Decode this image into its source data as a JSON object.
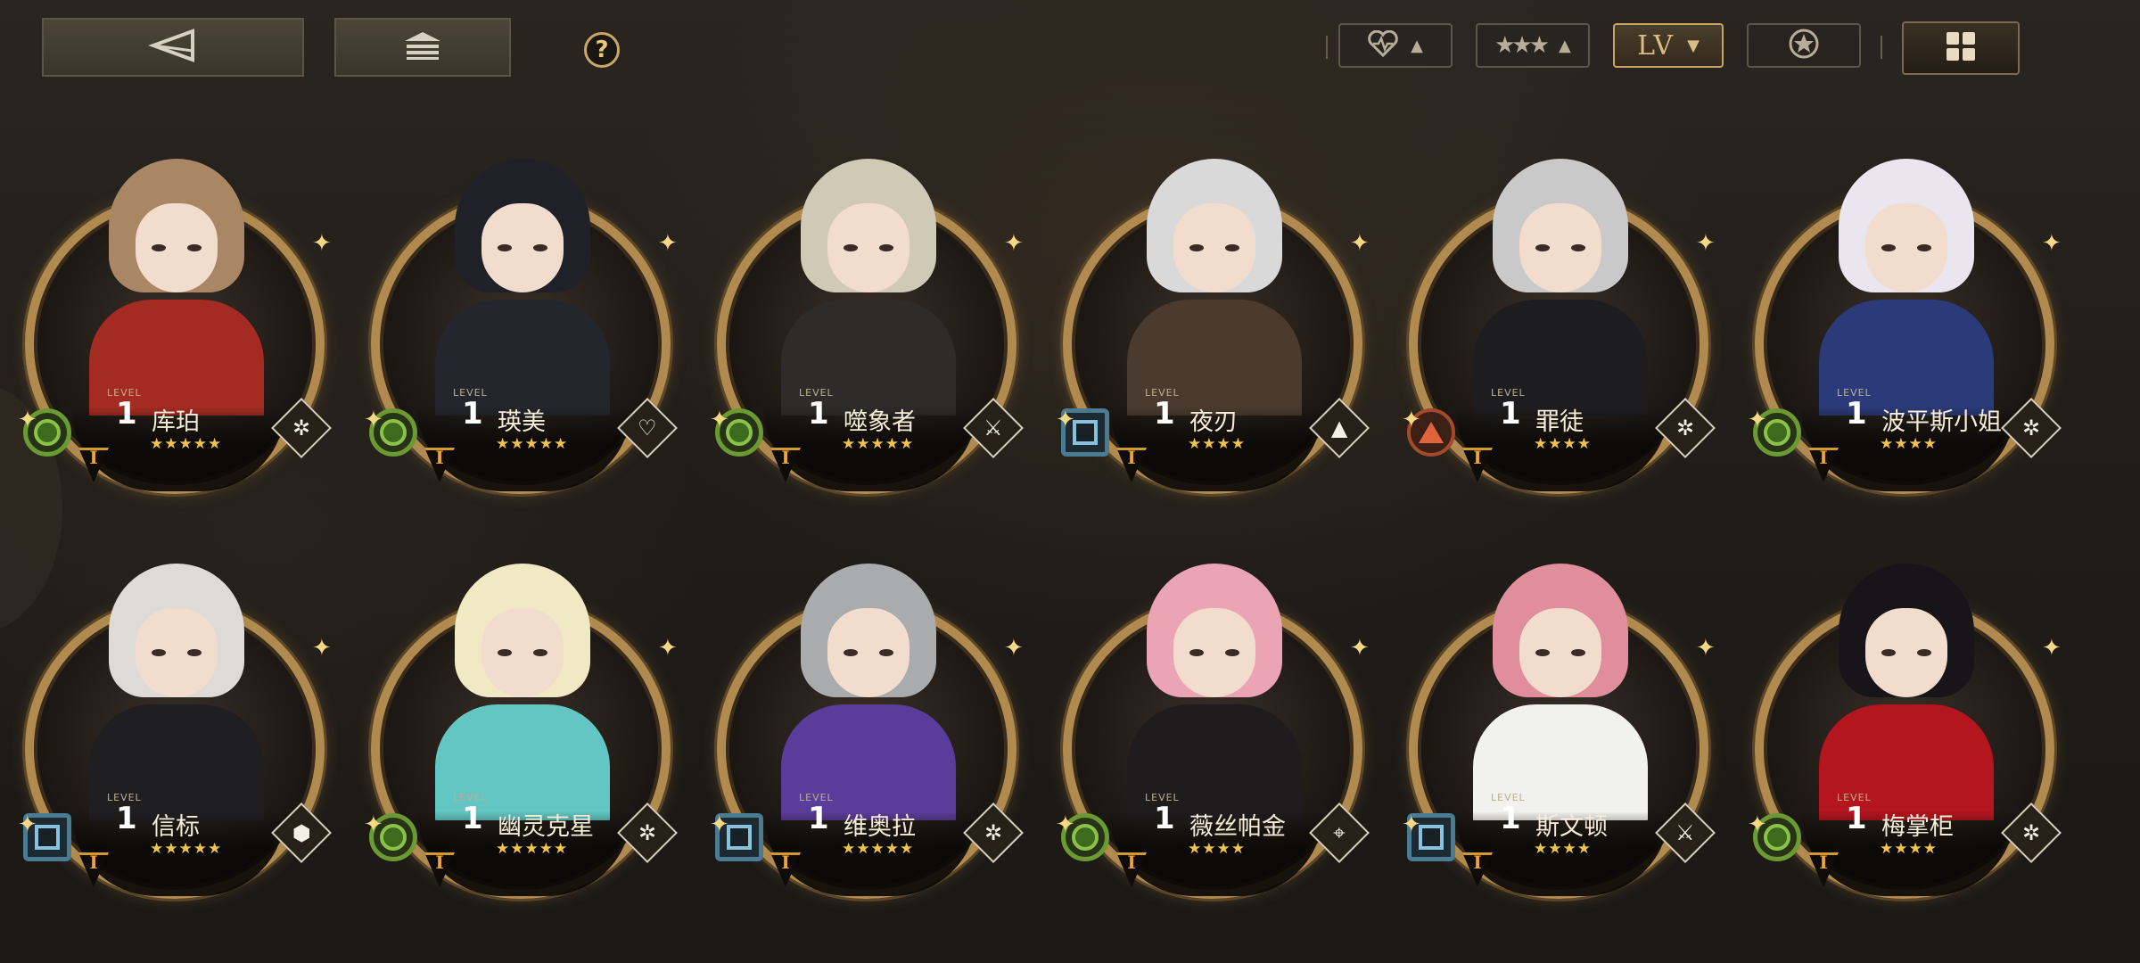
{
  "topbar": {
    "back_icon": "back-arrow-icon",
    "home_icon": "stack-icon",
    "help_label": "?",
    "filters": [
      {
        "icon": "heart-rate-icon",
        "caret": "▲",
        "active": false
      },
      {
        "icon": "three-stars-icon",
        "caret": "▲",
        "active": false
      },
      {
        "label": "LV",
        "caret": "▼",
        "active": true
      },
      {
        "icon": "star-badge-icon",
        "active": false
      }
    ],
    "layout_icon": "grid-icon"
  },
  "level_tag": "LEVEL",
  "characters": [
    {
      "name": "库珀",
      "level": "1",
      "rank": "I",
      "stars": "★★★★★",
      "element": "circle",
      "role_icon": "gear-flower-icon",
      "hair": "#a98664",
      "outfit": "#a32b22"
    },
    {
      "name": "瑛美",
      "level": "1",
      "rank": "I",
      "stars": "★★★★★",
      "element": "circle",
      "role_icon": "heart-shield-icon",
      "hair": "#1f2028",
      "outfit": "#23262c"
    },
    {
      "name": "噬象者",
      "level": "1",
      "rank": "I",
      "stars": "★★★★★",
      "element": "circle",
      "role_icon": "crossed-blades-icon",
      "hair": "#cfc9b6",
      "outfit": "#2e2c2a"
    },
    {
      "name": "夜刃",
      "level": "1",
      "rank": "I",
      "stars": "★★★★",
      "element": "square",
      "role_icon": "tent-icon",
      "hair": "#d9d9d9",
      "outfit": "#4a3b2e"
    },
    {
      "name": "罪徒",
      "level": "1",
      "rank": "I",
      "stars": "★★★★",
      "element": "triangle",
      "role_icon": "gear-flower-icon",
      "hair": "#c9c9c9",
      "outfit": "#1d1d1f"
    },
    {
      "name": "波平斯小姐",
      "level": "1",
      "rank": "I",
      "stars": "★★★★",
      "element": "circle",
      "role_icon": "gear-flower-icon",
      "hair": "#e9e6ef",
      "outfit": "#2b3a78"
    },
    {
      "name": "信标",
      "level": "1",
      "rank": "I",
      "stars": "★★★★★",
      "element": "square",
      "role_icon": "hex-cluster-icon",
      "hair": "#dedbd6",
      "outfit": "#1f1f22"
    },
    {
      "name": "幽灵克星",
      "level": "1",
      "rank": "I",
      "stars": "★★★★★",
      "element": "circle",
      "role_icon": "gear-flower-icon",
      "hair": "#f1e8c4",
      "outfit": "#63c6c3"
    },
    {
      "name": "维奥拉",
      "level": "1",
      "rank": "I",
      "stars": "★★★★★",
      "element": "square",
      "role_icon": "gear-flower-icon",
      "hair": "#a9abad",
      "outfit": "#5a3d9a"
    },
    {
      "name": "薇丝帕金",
      "level": "1",
      "rank": "I",
      "stars": "★★★★",
      "element": "circle",
      "role_icon": "crosshair-icon",
      "hair": "#eba4b4",
      "outfit": "#1f1c1e"
    },
    {
      "name": "斯文顿",
      "level": "1",
      "rank": "I",
      "stars": "★★★★",
      "element": "square",
      "role_icon": "crossed-blades-icon",
      "hair": "#e08e9c",
      "outfit": "#f1f1ee"
    },
    {
      "name": "梅掌柜",
      "level": "1",
      "rank": "I",
      "stars": "★★★★",
      "element": "circle",
      "role_icon": "gear-flower-icon",
      "hair": "#18151a",
      "outfit": "#b3161e"
    }
  ]
}
